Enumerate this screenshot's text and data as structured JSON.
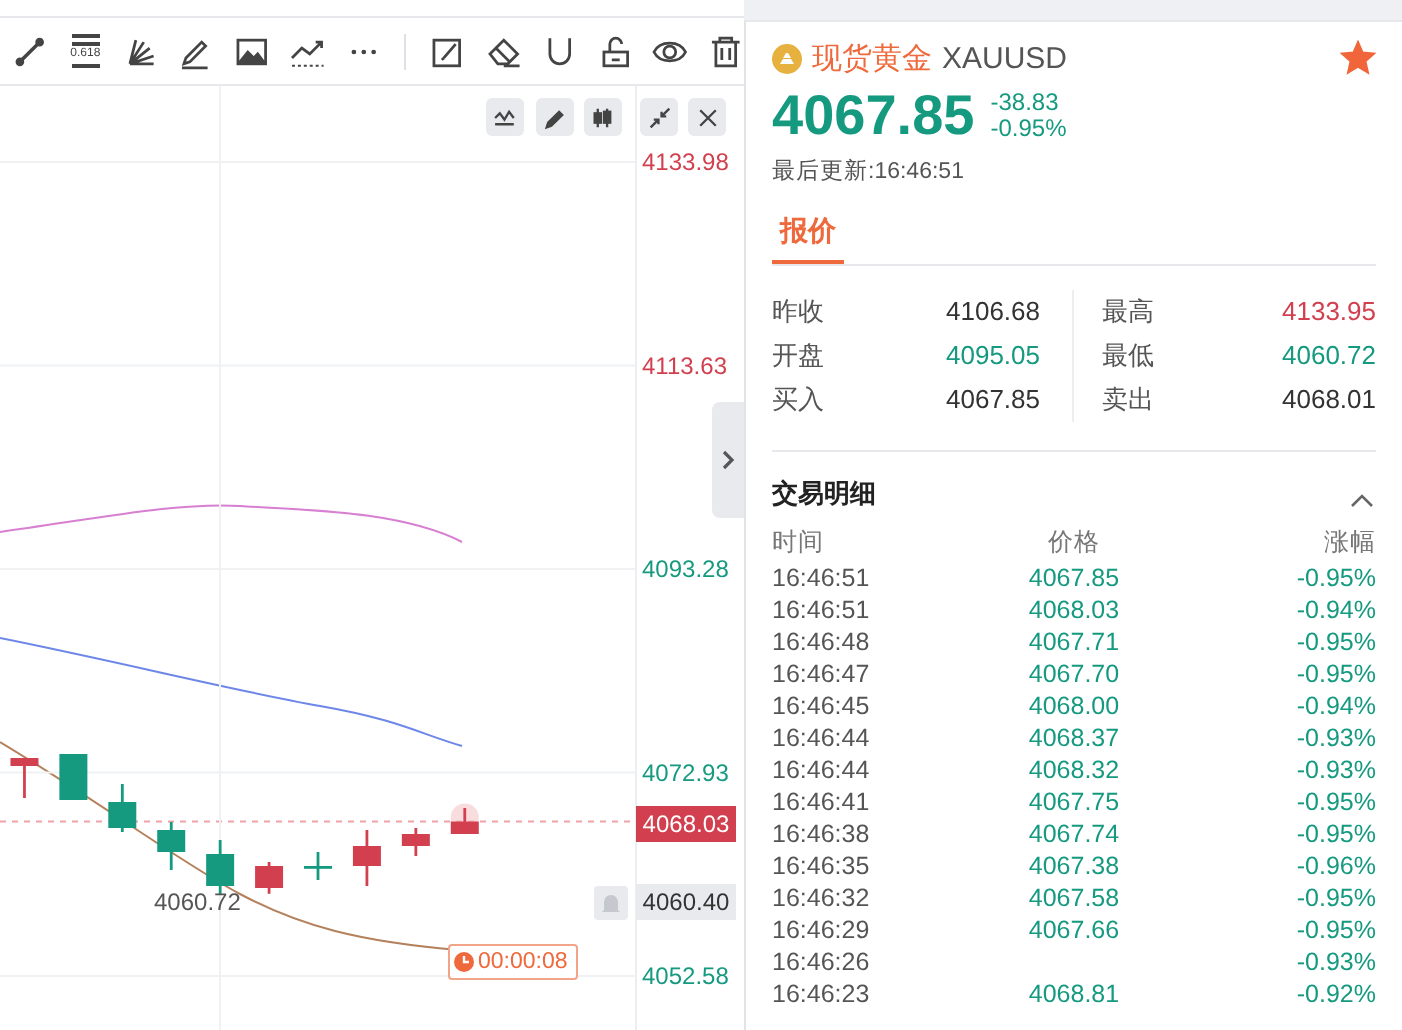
{
  "toolbar": {
    "fib_label": "0.618"
  },
  "chart": {
    "last_price": "4068.03",
    "alert_price": "4060.40",
    "low_label": "4060.72",
    "countdown": "00:00:08",
    "chart_data": {
      "type": "candlestick",
      "grid": true,
      "ohlc": [
        [
          4073.58,
          4074.38,
          4070.38,
          4074.38
        ],
        [
          4074.78,
          4074.78,
          4070.18,
          4070.18
        ],
        [
          4069.98,
          4071.78,
          4066.98,
          4067.38
        ],
        [
          4067.18,
          4067.98,
          4063.18,
          4064.98
        ],
        [
          4064.78,
          4066.18,
          4060.72,
          4061.58
        ],
        [
          4061.38,
          4063.98,
          4060.8,
          4063.58
        ],
        [
          4063.58,
          4064.98,
          4062.18,
          4063.48
        ],
        [
          4063.58,
          4067.18,
          4061.58,
          4065.58
        ],
        [
          4065.58,
          4067.38,
          4064.58,
          4066.78
        ],
        [
          4066.78,
          4069.38,
          4066.78,
          4068.03
        ],
        null,
        null,
        null
      ],
      "ylim": [
        4046.98,
        4141.58
      ],
      "yticks": [
        {
          "value": 4133.98,
          "label": "4133.98"
        },
        {
          "value": 4113.63,
          "label": "4113.63"
        },
        {
          "value": 4093.28,
          "label": "4093.28"
        },
        {
          "value": 4072.93,
          "label": "4072.93"
        },
        {
          "value": 4052.58,
          "label": "4052.58"
        }
      ]
    }
  },
  "quote": {
    "name": "现货黄金",
    "symbol": "XAUUSD",
    "favorite": true,
    "price": "4067.85",
    "change": "-38.83",
    "change_pct": "-0.95%",
    "updated": "最后更新:16:46:51"
  },
  "tabs": [
    {
      "label": "报价",
      "selected": true
    }
  ],
  "stats": [
    {
      "label": "昨收",
      "value": "4106.68",
      "color": "#333333"
    },
    {
      "label": "最高",
      "value": "4133.95",
      "color": "#d2404f"
    },
    {
      "label": "开盘",
      "value": "4095.05",
      "color": "#159a80"
    },
    {
      "label": "最低",
      "value": "4060.72",
      "color": "#159a80"
    },
    {
      "label": "买入",
      "value": "4067.85",
      "color": "#333333"
    },
    {
      "label": "卖出",
      "value": "4068.01",
      "color": "#333333"
    }
  ],
  "trades": {
    "title": "交易明细",
    "expanded": true,
    "columns": [
      "时间",
      "价格",
      "涨幅"
    ],
    "rows": [
      {
        "time": "16:46:51",
        "price": "4067.85",
        "change": "-0.95%"
      },
      {
        "time": "16:46:51",
        "price": "4068.03",
        "change": "-0.94%"
      },
      {
        "time": "16:46:48",
        "price": "4067.71",
        "change": "-0.95%"
      },
      {
        "time": "16:46:47",
        "price": "4067.70",
        "change": "-0.95%"
      },
      {
        "time": "16:46:45",
        "price": "4068.00",
        "change": "-0.94%"
      },
      {
        "time": "16:46:44",
        "price": "4068.37",
        "change": "-0.93%"
      },
      {
        "time": "16:46:44",
        "price": "4068.32",
        "change": "-0.93%"
      },
      {
        "time": "16:46:41",
        "price": "4067.75",
        "change": "-0.95%"
      },
      {
        "time": "16:46:38",
        "price": "4067.74",
        "change": "-0.95%"
      },
      {
        "time": "16:46:35",
        "price": "4067.38",
        "change": "-0.96%"
      },
      {
        "time": "16:46:32",
        "price": "4067.58",
        "change": "-0.95%"
      },
      {
        "time": "16:46:29",
        "price": "4067.66",
        "change": "-0.95%"
      },
      {
        "time": "16:46:26",
        "change": "-0.93%"
      },
      {
        "time": "16:46:23",
        "price": "4068.81",
        "change": "-0.92%"
      }
    ]
  }
}
